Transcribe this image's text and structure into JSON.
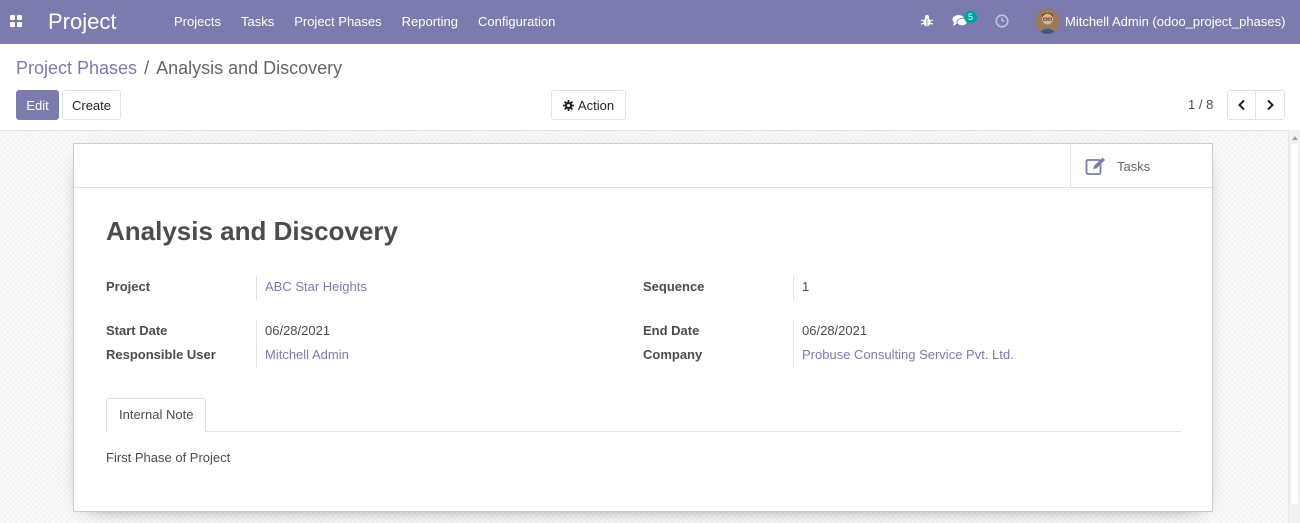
{
  "navbar": {
    "brand": "Project",
    "menu": [
      "Projects",
      "Tasks",
      "Project Phases",
      "Reporting",
      "Configuration"
    ],
    "chat_count": "5",
    "user": "Mitchell Admin (odoo_project_phases)",
    "icons": [
      "apps-icon",
      "bug-icon",
      "chat-icon",
      "clock-icon"
    ]
  },
  "breadcrumb": {
    "parent": "Project Phases",
    "separator": "/",
    "current": "Analysis and Discovery"
  },
  "buttons": {
    "edit": "Edit",
    "create": "Create",
    "action": "Action"
  },
  "pager": {
    "value": "1 / 8"
  },
  "smart_button": {
    "label": "Tasks"
  },
  "record": {
    "title": "Analysis and Discovery",
    "fields": {
      "project": {
        "label": "Project",
        "value": "ABC Star Heights"
      },
      "sequence": {
        "label": "Sequence",
        "value": "1"
      },
      "start_date": {
        "label": "Start Date",
        "value": "06/28/2021"
      },
      "end_date": {
        "label": "End Date",
        "value": "06/28/2021"
      },
      "responsible": {
        "label": "Responsible User",
        "value": "Mitchell Admin"
      },
      "company": {
        "label": "Company",
        "value": "Probuse Consulting Service Pvt. Ltd."
      }
    }
  },
  "notebook": {
    "tab": "Internal Note",
    "content": "First Phase of Project"
  },
  "colors": {
    "primary": "#7c7bad",
    "badge": "#00a09d"
  }
}
